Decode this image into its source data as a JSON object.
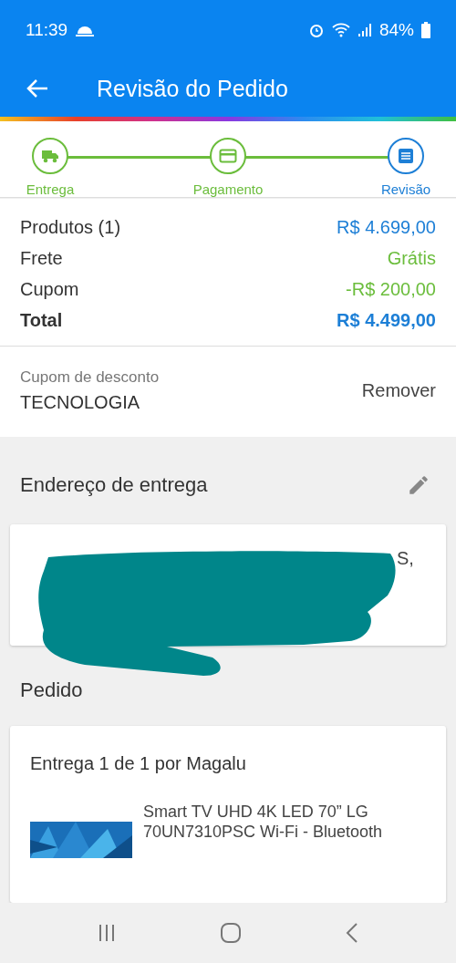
{
  "status_bar": {
    "time": "11:39",
    "battery": "84%"
  },
  "app_bar": {
    "title": "Revisão do Pedido"
  },
  "steps": [
    {
      "label": "Entrega",
      "kind": "truck",
      "selected": false
    },
    {
      "label": "Pagamento",
      "kind": "card",
      "selected": false
    },
    {
      "label": "Revisão",
      "kind": "list",
      "selected": true
    }
  ],
  "summary": [
    {
      "label": "Produtos (1)",
      "value": "R$ 4.699,00",
      "kind": "price"
    },
    {
      "label": "Frete",
      "value": "Grátis",
      "kind": "discount"
    },
    {
      "label": "Cupom",
      "value": "-R$ 200,00",
      "kind": "discount"
    },
    {
      "label": "Total",
      "value": "R$ 4.499,00",
      "kind": "total"
    }
  ],
  "coupon": {
    "label": "Cupom de desconto",
    "code": "TECNOLOGIA",
    "action": "Remover"
  },
  "address": {
    "title": "Endereço de entrega",
    "visible_text": "S,"
  },
  "order": {
    "title": "Pedido",
    "delivery": "Entrega 1 de 1 por Magalu",
    "product": {
      "name": "Smart TV UHD 4K LED 70” LG 70UN7310PSC Wi-Fi - Bluetooth"
    }
  }
}
